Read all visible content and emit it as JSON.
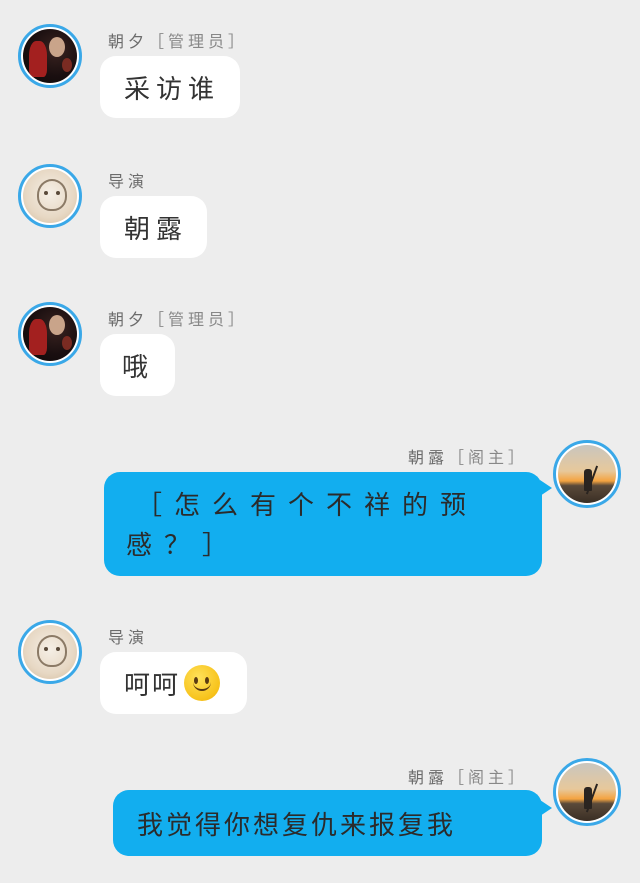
{
  "messages": [
    {
      "sender": "朝夕",
      "tag": "［管理员］",
      "side": "left",
      "avatar": "dark-portrait-avatar",
      "text": "采访谁"
    },
    {
      "sender": "导演",
      "tag": "",
      "side": "left",
      "avatar": "sketch-girl-avatar",
      "text": "朝露"
    },
    {
      "sender": "朝夕",
      "tag": "［管理员］",
      "side": "left",
      "avatar": "dark-portrait-avatar",
      "text": "哦"
    },
    {
      "sender": "朝露",
      "tag": "［阁主］",
      "side": "right",
      "avatar": "sunset-figure-avatar",
      "line1": "［怎么有个不祥的预",
      "line2": "感？］"
    },
    {
      "sender": "导演",
      "tag": "",
      "side": "left",
      "avatar": "sketch-girl-avatar",
      "text": "呵呵",
      "emoji": "slightly-smiling-face-icon"
    },
    {
      "sender": "朝露",
      "tag": "［阁主］",
      "side": "right",
      "avatar": "sunset-figure-avatar",
      "text": "我觉得你想复仇来报复我"
    }
  ],
  "colors": {
    "background": "#ededed",
    "bubble_left": "#ffffff",
    "bubble_right": "#12aeef",
    "avatar_ring": "#3aa8e8"
  }
}
